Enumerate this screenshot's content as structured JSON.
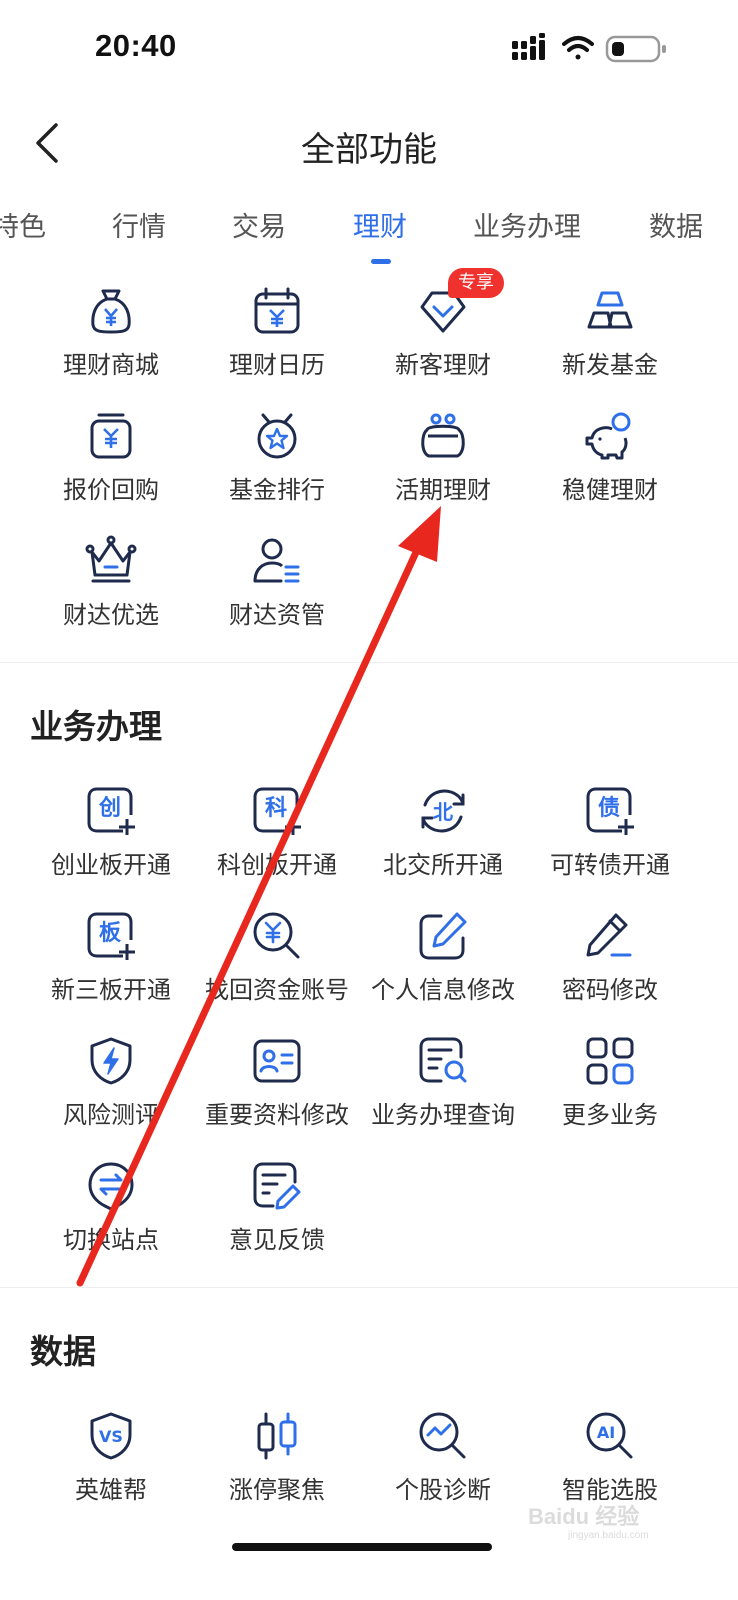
{
  "status_bar": {
    "time": "20:40"
  },
  "header": {
    "title": "全部功能"
  },
  "tabs": [
    {
      "label": "特色"
    },
    {
      "label": "行情"
    },
    {
      "label": "交易"
    },
    {
      "label": "理财",
      "active": true
    },
    {
      "label": "业务办理"
    },
    {
      "label": "数据"
    }
  ],
  "licai": {
    "items": [
      {
        "label": "理财商城",
        "icon": "money-bag-icon"
      },
      {
        "label": "理财日历",
        "icon": "calendar-yuan-icon"
      },
      {
        "label": "新客理财",
        "icon": "diamond-heart-icon",
        "badge": "专享"
      },
      {
        "label": "新发基金",
        "icon": "gold-bars-icon"
      },
      {
        "label": "报价回购",
        "icon": "yuan-box-icon"
      },
      {
        "label": "基金排行",
        "icon": "star-medal-icon"
      },
      {
        "label": "活期理财",
        "icon": "purse-icon"
      },
      {
        "label": "稳健理财",
        "icon": "piggy-bank-icon"
      },
      {
        "label": "财达优选",
        "icon": "crown-icon"
      },
      {
        "label": "财达资管",
        "icon": "person-list-icon"
      }
    ]
  },
  "business": {
    "title": "业务办理",
    "items": [
      {
        "label": "创业板开通",
        "icon": "chuang-plus-icon",
        "glyph": "创"
      },
      {
        "label": "科创板开通",
        "icon": "ke-plus-icon",
        "glyph": "科"
      },
      {
        "label": "北交所开通",
        "icon": "bei-refresh-icon",
        "glyph": "北"
      },
      {
        "label": "可转债开通",
        "icon": "zhai-plus-icon",
        "glyph": "债"
      },
      {
        "label": "新三板开通",
        "icon": "ban-plus-icon",
        "glyph": "板"
      },
      {
        "label": "找回资金账号",
        "icon": "yuan-search-icon"
      },
      {
        "label": "个人信息修改",
        "icon": "edit-box-icon"
      },
      {
        "label": "密码修改",
        "icon": "pencil-icon"
      },
      {
        "label": "风险测评",
        "icon": "shield-bolt-icon"
      },
      {
        "label": "重要资料修改",
        "icon": "id-card-icon"
      },
      {
        "label": "业务办理查询",
        "icon": "document-search-icon"
      },
      {
        "label": "更多业务",
        "icon": "grid-apps-icon"
      },
      {
        "label": "切换站点",
        "icon": "switch-arrows-icon"
      },
      {
        "label": "意见反馈",
        "icon": "feedback-edit-icon"
      }
    ]
  },
  "data_section": {
    "title": "数据",
    "items": [
      {
        "label": "英雄帮",
        "icon": "vs-shield-icon",
        "glyph": "VS"
      },
      {
        "label": "涨停聚焦",
        "icon": "candlestick-icon"
      },
      {
        "label": "个股诊断",
        "icon": "chart-search-icon"
      },
      {
        "label": "智能选股",
        "icon": "ai-search-icon",
        "glyph": "AI"
      }
    ]
  },
  "watermark": {
    "text": "Baidu 经验",
    "subtext": "jingyan.baidu.com"
  },
  "colors": {
    "accent": "#2f6fe8",
    "icon_dark": "#1f2b4d",
    "badge": "#f0322f",
    "arrow": "#e8281e"
  }
}
